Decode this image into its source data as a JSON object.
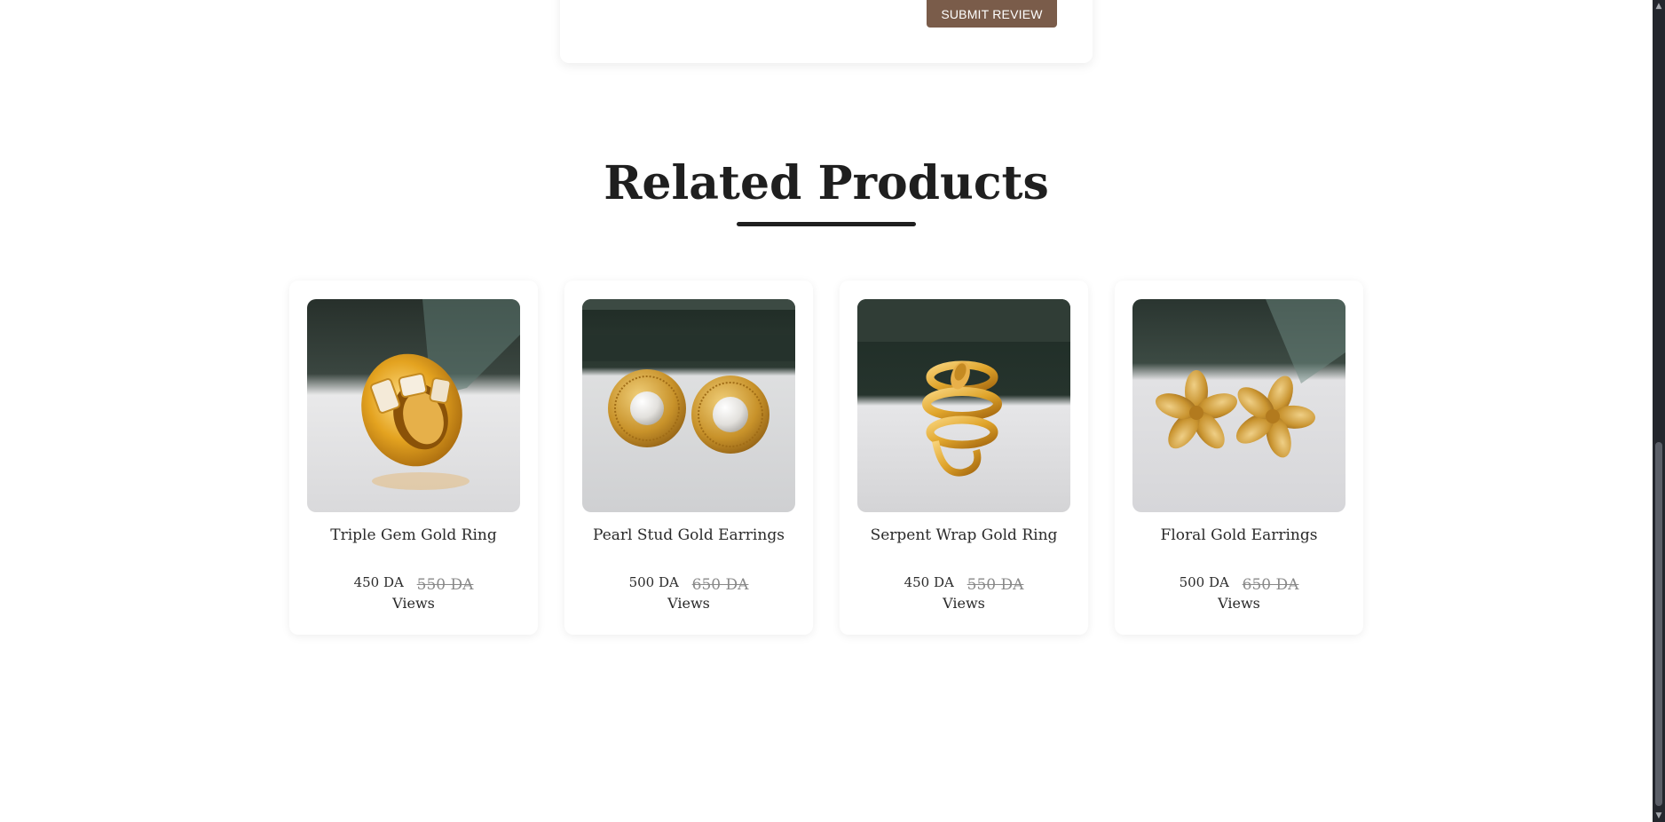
{
  "review": {
    "submit_label": "SUBMIT REVIEW"
  },
  "related": {
    "title": "Related Products",
    "products": [
      {
        "name": "Triple Gem Gold Ring",
        "price": "450 DA",
        "old_price": "550 DA",
        "views": "Views",
        "image_icon": "gold-ring-image"
      },
      {
        "name": "Pearl Stud Gold Earrings",
        "price": "500 DA",
        "old_price": "650 DA",
        "views": "Views",
        "image_icon": "pearl-earrings-image"
      },
      {
        "name": "Serpent Wrap Gold Ring",
        "price": "450 DA",
        "old_price": "550 DA",
        "views": "Views",
        "image_icon": "serpent-ring-image"
      },
      {
        "name": "Floral Gold Earrings",
        "price": "500 DA",
        "old_price": "650 DA",
        "views": "Views",
        "image_icon": "floral-earrings-image"
      }
    ]
  },
  "colors": {
    "accent_button": "#7a5c4a",
    "heading": "#1f1f1f",
    "old_price": "#8a8a8a",
    "scrollbar": "#23262d"
  }
}
